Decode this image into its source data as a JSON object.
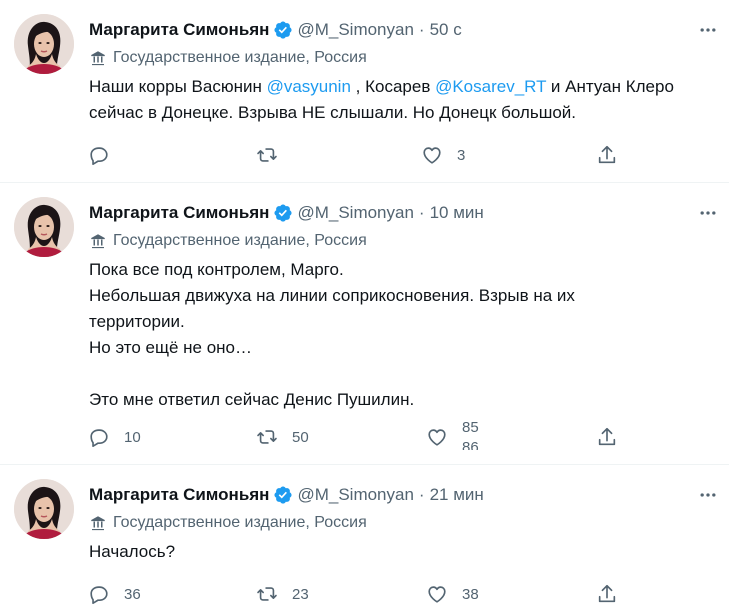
{
  "tweets": [
    {
      "name": "Маргарита Симоньян",
      "handle": "@M_Simonyan",
      "time": "50 с",
      "label": "Государственное издание, Россия",
      "text_parts": [
        "Наши корры Васюнин ",
        "@vasyunin",
        " , Косарев ",
        "@Kosarev_RT",
        " и Антуан Клеро\nсейчас в Донецке. Взрыва НЕ слышали. Но Донецк большой."
      ],
      "replies": "",
      "retweets": "",
      "likes": "3"
    },
    {
      "name": "Маргарита Симоньян",
      "handle": "@M_Simonyan",
      "time": "10 мин",
      "label": "Государственное издание, Россия",
      "text": "Пока все под контролем, Марго.\nНебольшая движуха на линии соприкосновения. Взрыв на их\nтерритории.\nНо это ещё не оно…\n\nЭто мне ответил сейчас Денис Пушилин.",
      "replies": "10",
      "retweets": "50",
      "likes_old": "85",
      "likes_new": "86"
    },
    {
      "name": "Маргарита Симоньян",
      "handle": "@M_Simonyan",
      "time": "21 мин",
      "label": "Государственное издание, Россия",
      "text": "Началось?",
      "replies": "36",
      "retweets": "23",
      "likes": "38"
    }
  ],
  "icons": {
    "verified": "verified-badge-icon",
    "more": "more-dots-icon",
    "label": "government-building-icon",
    "reply": "reply-bubble-icon",
    "retweet": "retweet-icon",
    "like": "heart-icon",
    "share": "share-icon"
  },
  "colors": {
    "text": "#0f1419",
    "secondary": "#536471",
    "link": "#1d9bf0",
    "verified": "#1d9bf0",
    "divider": "#eff3f4"
  }
}
